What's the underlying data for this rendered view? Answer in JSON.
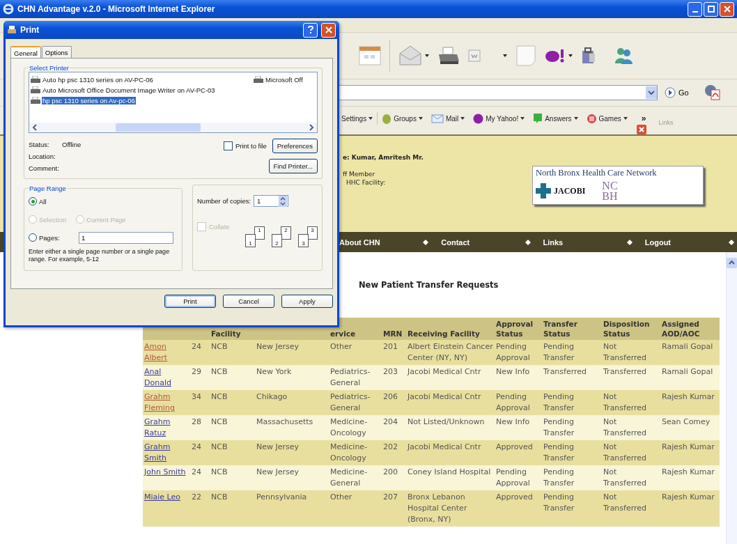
{
  "browser": {
    "title": "CHN Advantage v.2.0 - Microsoft Internet Explorer",
    "go": "Go",
    "links_label": "Links",
    "overflow": "»",
    "links_bar": [
      {
        "label": "Settings",
        "kind": "text"
      },
      {
        "label": "Groups",
        "kind": "groups"
      },
      {
        "label": "Mail",
        "kind": "mail"
      },
      {
        "label": "My Yahoo!",
        "kind": "yahoo"
      },
      {
        "label": "Answers",
        "kind": "answers"
      },
      {
        "label": "Games",
        "kind": "games"
      }
    ]
  },
  "header": {
    "user_line": "e: Kumar, Amritesh Mr.",
    "role_line": "ff Member",
    "facility_line": "HHC Facility:",
    "logo": {
      "title": "North Bronx Health Care Network",
      "jacobi": "JACOBI",
      "nc": "NC",
      "bh": "BH"
    }
  },
  "nav": [
    "About CHN",
    "Contact",
    "Links",
    "Logout"
  ],
  "page": {
    "heading": "New Patient Transfer Requests"
  },
  "table": {
    "columns": [
      {},
      {},
      {
        "label": "Facility"
      },
      {},
      {
        "label": "ervice"
      },
      {
        "label": "MRN"
      },
      {
        "label": "Receiving Facility"
      },
      {
        "label": "Approval Status"
      },
      {
        "label": "Transfer Status"
      },
      {
        "label": "Disposition Status"
      },
      {
        "label": "Assigned AOD/AOC"
      }
    ],
    "rows": [
      {
        "visited": true,
        "cells": [
          "Amon Albert",
          "24",
          "NCB",
          "New Jersey",
          "Other",
          "201",
          "Albert Einstein Cancer Center (NY, NY)",
          "Pending Approval",
          "Pending Transfer",
          "Not Transferred",
          "Ramali Gopal"
        ]
      },
      {
        "visited": false,
        "cells": [
          "Anal Donald",
          "29",
          "NCB",
          "New York",
          "Pediatrics-General",
          "203",
          "Jacobi Medical Cntr",
          "New Info",
          "Transferred",
          "Transferred",
          "Ramali Gopal"
        ]
      },
      {
        "visited": true,
        "cells": [
          "Grahm Fleming",
          "34",
          "NCB",
          "Chikago",
          "Pediatrics-General",
          "206",
          "Jacobi Medical Cntr",
          "Pending Approval",
          "Pending Transfer",
          "Not Transferred",
          "Rajesh Kumar"
        ]
      },
      {
        "visited": false,
        "cells": [
          "Grahm Ratuz",
          "28",
          "NCB",
          "Massachusetts",
          "Medicine-Oncology",
          "204",
          "Not Listed/Unknown",
          "New Info",
          "Pending Transfer",
          "Not Transferred",
          "Sean Comey"
        ]
      },
      {
        "visited": false,
        "cells": [
          "Grahm Smith",
          "24",
          "NCB",
          "New Jersey",
          "Medicine-Oncology",
          "202",
          "Jacobi Medical Cntr",
          "Approved",
          "Pending Transfer",
          "Not Transferred",
          "Rajesh Kumar"
        ]
      },
      {
        "visited": false,
        "cells": [
          "John Smith",
          "24",
          "NCB",
          "New Jersey",
          "Medicine-General",
          "200",
          "Coney Island Hospital",
          "Pending Approval",
          "Pending Transfer",
          "Not Transferred",
          "Rajesh Kumar"
        ]
      },
      {
        "visited": false,
        "cells": [
          "Miaie Leo",
          "22",
          "NCB",
          "Pennsylvania",
          "Other",
          "207",
          "Bronx Lebanon Hospital Center (Bronx, NY)",
          "Approved",
          "Pending Transfer",
          "Not Transferred",
          "Rajesh Kumar"
        ]
      }
    ]
  },
  "print_dialog": {
    "title": "Print",
    "tabs": [
      {
        "label": "General",
        "selected": true
      },
      {
        "label": "Options",
        "selected": false
      }
    ],
    "select_printer": {
      "legend": "Select Printer",
      "printers": [
        {
          "name": "Auto hp psc 1310 series on AV-PC-06",
          "selected": false
        },
        {
          "name": "Auto Microsoft Office Document Image Writer on AV-PC-03",
          "selected": false
        },
        {
          "name": "hp psc 1310 series on Av-pc-06",
          "selected": true
        },
        {
          "name": "Microsoft Off",
          "selected": false
        }
      ],
      "status_label": "Status:",
      "status": "Offline",
      "location_label": "Location:",
      "comment_label": "Comment:",
      "print_to_file": {
        "label": "Print to file",
        "checked": false
      },
      "preferences": "Preferences",
      "find_printer": "Find Printer..."
    },
    "page_range": {
      "legend": "Page Range",
      "options": [
        {
          "label": "All",
          "selected": true,
          "disabled": false
        },
        {
          "label": "Selection",
          "selected": false,
          "disabled": true
        },
        {
          "label": "Current Page",
          "selected": false,
          "disabled": true
        },
        {
          "label": "Pages:",
          "selected": false,
          "disabled": false
        }
      ],
      "pages_value": "1",
      "hint": "Enter either a single page number or a single page range.  For example, 5-12"
    },
    "copies": {
      "label": "Number of copies:",
      "value": "1",
      "collate": {
        "label": "Collate",
        "checked": false,
        "disabled": true
      },
      "stacks": [
        {
          "back": "1",
          "front": "1"
        },
        {
          "back": "2",
          "front": "2"
        },
        {
          "back": "3",
          "front": "3"
        }
      ]
    },
    "buttons": [
      "Print",
      "Cancel",
      "Apply"
    ]
  }
}
